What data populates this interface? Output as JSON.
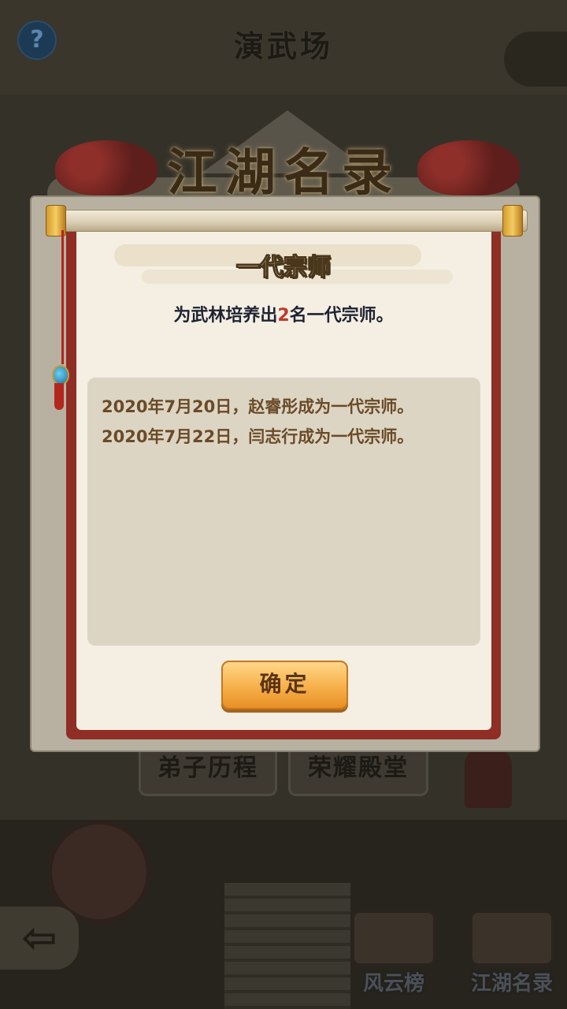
{
  "page": {
    "title": "演武场"
  },
  "banner": {
    "title": "江湖名录"
  },
  "modal": {
    "title": "一代宗师",
    "description_prefix": "为武林培养出",
    "description_count": "2",
    "description_suffix": "名一代宗师。",
    "records": [
      "2020年7月20日，赵睿彤成为一代宗师。",
      "2020年7月22日，闫志行成为一代宗师。"
    ],
    "confirm_label": "确定"
  },
  "background_tabs": {
    "disciple_history": "弟子历程",
    "hall_of_honor": "荣耀殿堂"
  },
  "bottom_nav": {
    "fengyun_rank": "风云榜",
    "jianghu_records": "江湖名录"
  },
  "colors": {
    "scroll_red": "#8f2e25",
    "paper": "#f4efe2",
    "record_box": "#ddd5c4",
    "record_text": "#6a4a27",
    "highlight_count": "#c0392b",
    "confirm_button": "#f7b04a"
  },
  "icons": {
    "help": "question-mark-icon",
    "back": "back-arrow-icon",
    "fengyun": "scroll-icon",
    "jianghu": "book-icon"
  }
}
